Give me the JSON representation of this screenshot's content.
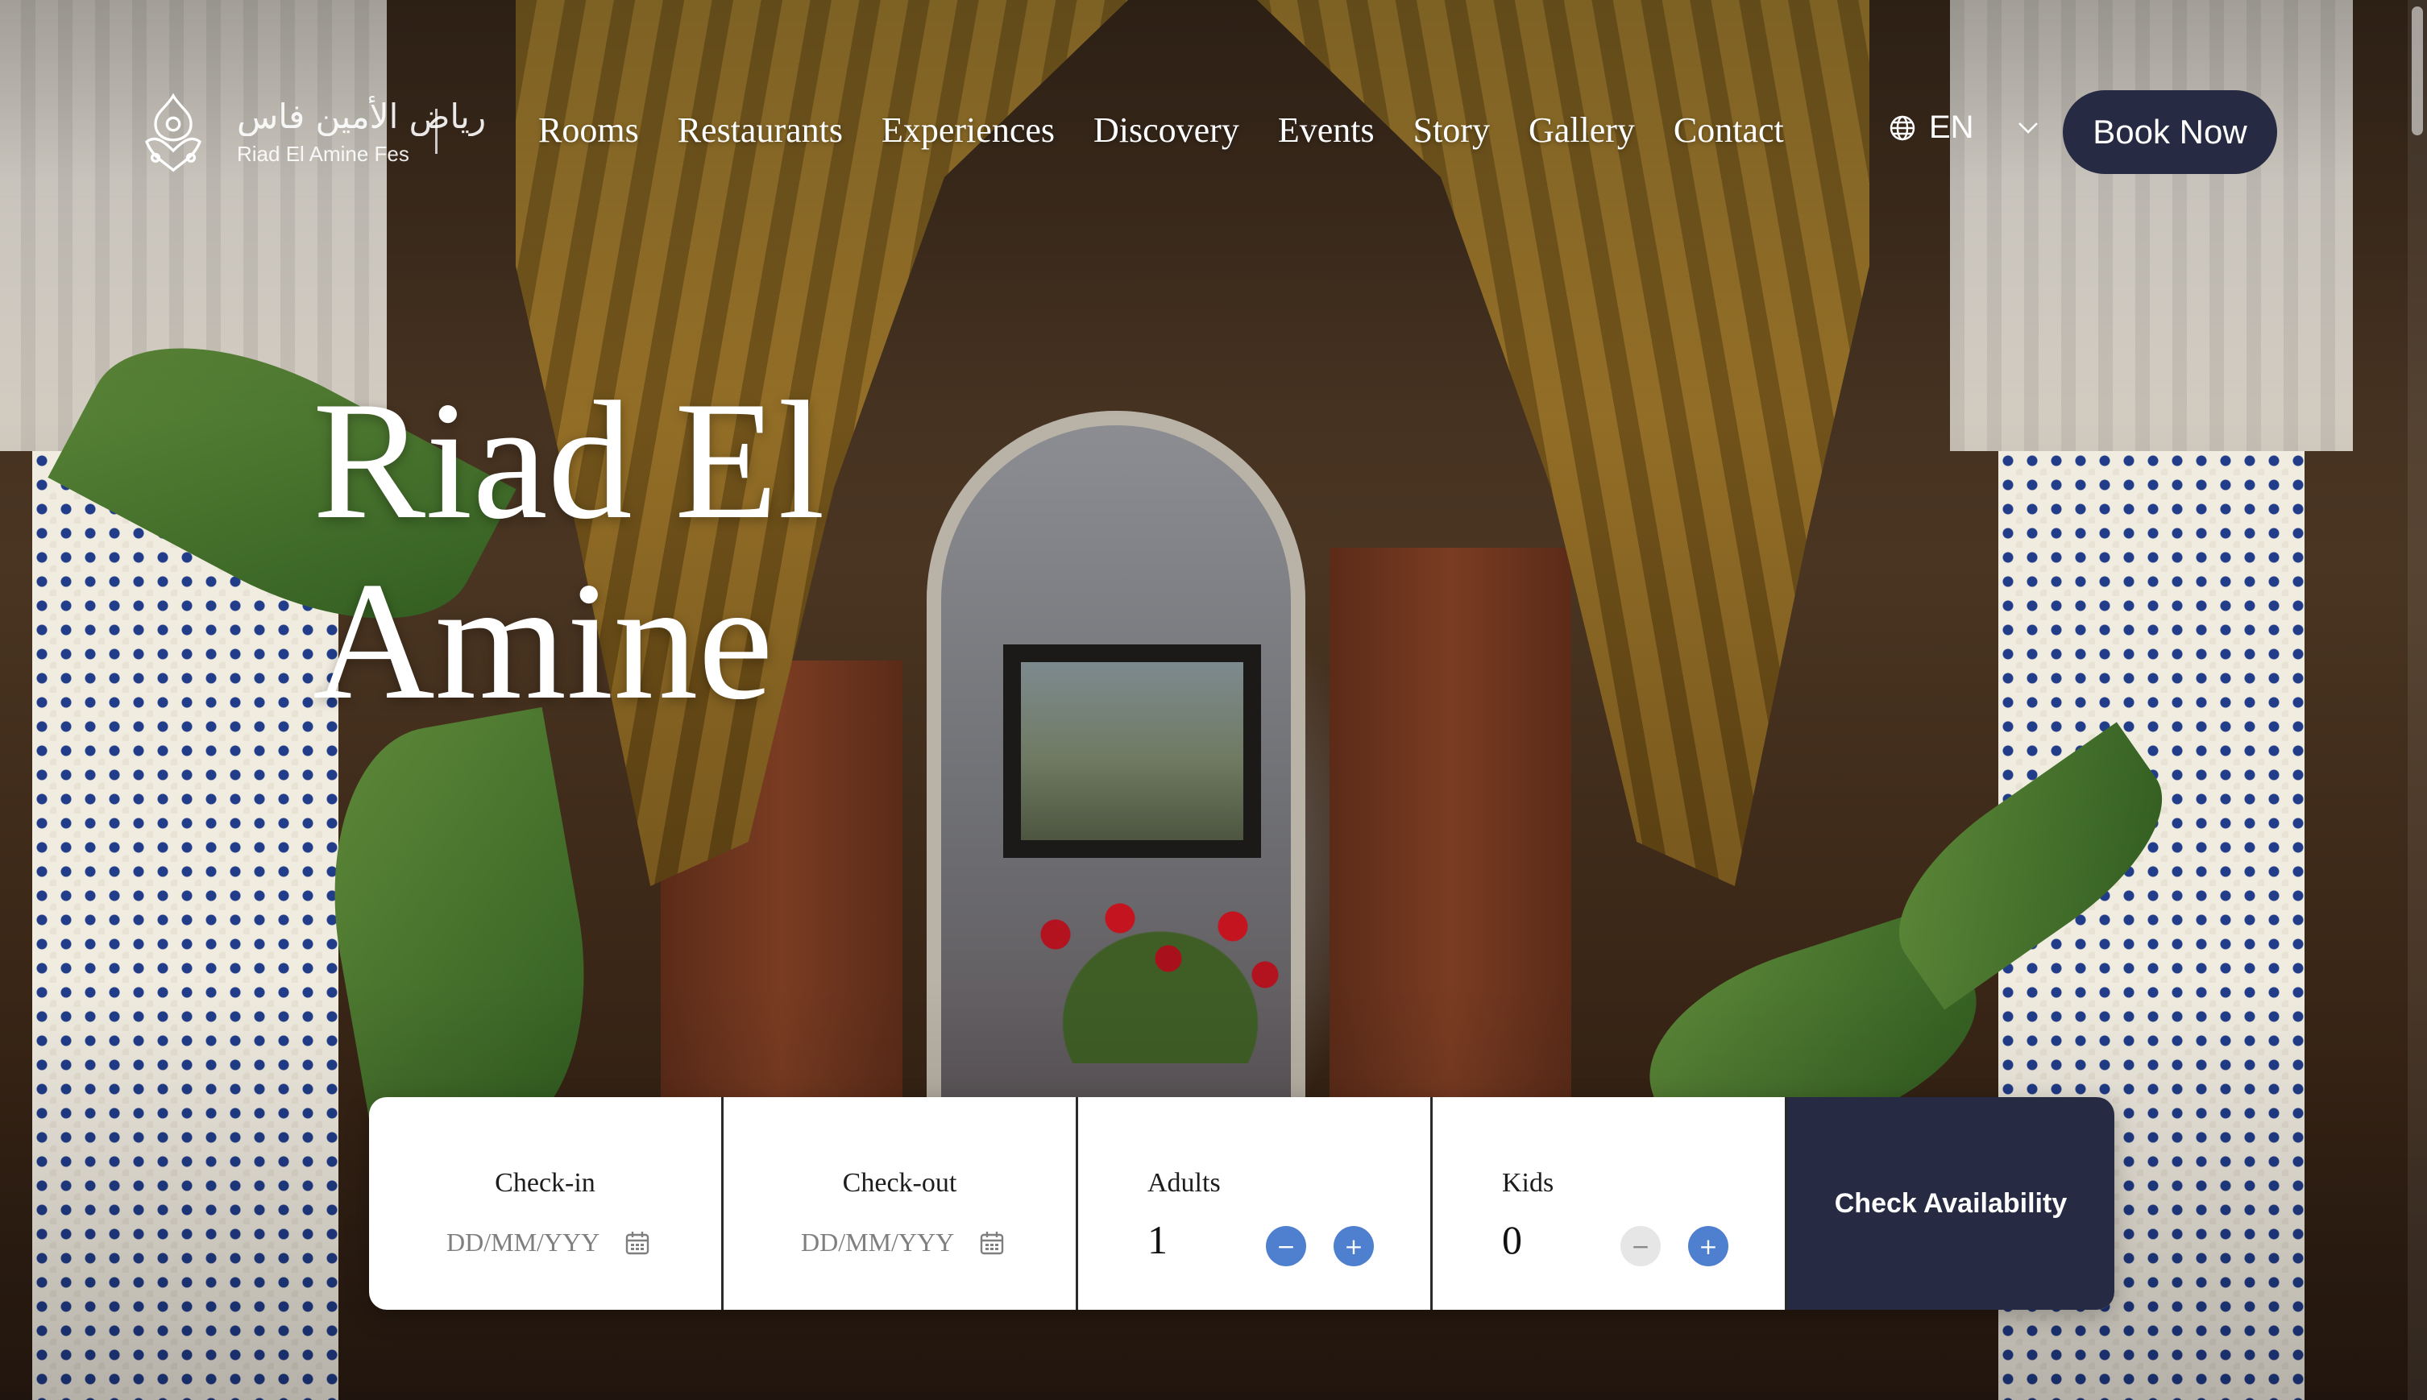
{
  "brand": {
    "logo_arabic": "رياض الأمين فاس",
    "logo_latin": "Riad El Amine Fes"
  },
  "nav": {
    "items": [
      "Rooms",
      "Restaurants",
      "Experiences",
      "Discovery",
      "Events",
      "Story",
      "Gallery",
      "Contact"
    ]
  },
  "language": {
    "current": "EN",
    "icon": "globe-icon",
    "dropdown_icon": "chevron-down-icon"
  },
  "book_now": {
    "label": "Book Now"
  },
  "hero": {
    "title_line1": "Riad El",
    "title_line2": "Amine"
  },
  "booking": {
    "check_in": {
      "label": "Check-in",
      "placeholder": "DD/MM/YYY",
      "icon": "calendar-icon"
    },
    "check_out": {
      "label": "Check-out",
      "placeholder": "DD/MM/YYY",
      "icon": "calendar-icon"
    },
    "adults": {
      "label": "Adults",
      "value": "1",
      "minus": "−",
      "plus": "+"
    },
    "kids": {
      "label": "Kids",
      "value": "0",
      "minus": "−",
      "plus": "+"
    },
    "submit_label": "Check Availability"
  },
  "colors": {
    "primary_dark": "#262a42",
    "counter_blue": "#4f7fcf",
    "white": "#ffffff"
  }
}
